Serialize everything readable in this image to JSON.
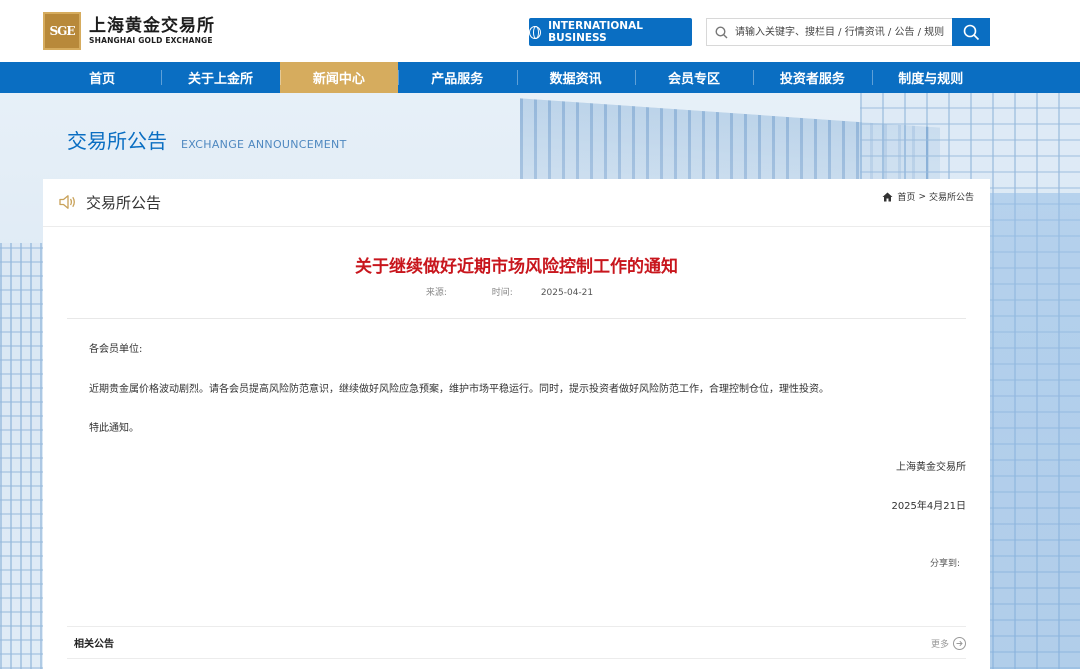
{
  "header": {
    "logo_mark": "SGE",
    "logo_cn": "上海黄金交易所",
    "logo_en": "SHANGHAI GOLD EXCHANGE",
    "intl_button": "INTERNATIONAL BUSINESS",
    "search_placeholder": "请输入关键字、搜栏目 / 行情资讯 / 公告 / 规则"
  },
  "nav": {
    "items": [
      {
        "label": "首页"
      },
      {
        "label": "关于上金所"
      },
      {
        "label": "新闻中心"
      },
      {
        "label": "产品服务"
      },
      {
        "label": "数据资讯"
      },
      {
        "label": "会员专区"
      },
      {
        "label": "投资者服务"
      },
      {
        "label": "制度与规则"
      }
    ],
    "active": "新闻中心"
  },
  "page_heading": {
    "cn": "交易所公告",
    "en": "EXCHANGE ANNOUNCEMENT"
  },
  "card": {
    "title": "交易所公告",
    "breadcrumb": {
      "home": "首页",
      "separator": ">",
      "current": "交易所公告"
    }
  },
  "article": {
    "title": "关于继续做好近期市场风险控制工作的通知",
    "source_label": "来源:",
    "time_label": "时间:",
    "time_value": "2025-04-21",
    "salutation": "各会员单位:",
    "paragraph": "近期贵金属价格波动剧烈。请各会员提高风险防范意识，继续做好风险应急预案，维护市场平稳运行。同时，提示投资者做好风险防范工作，合理控制仓位，理性投资。",
    "closing": "特此通知。",
    "signature": "上海黄金交易所",
    "date": "2025年4月21日",
    "share_label": "分享到:"
  },
  "related": {
    "title": "相关公告",
    "more": "更多"
  },
  "colors": {
    "brand_blue": "#0a6ec2",
    "active_gold": "#d6ac5e",
    "title_red": "#c8161d"
  }
}
